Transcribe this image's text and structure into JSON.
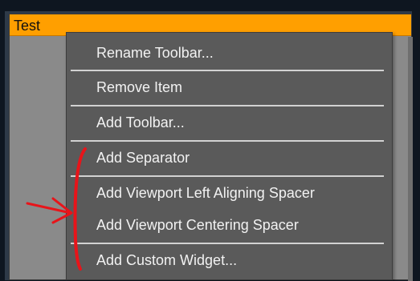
{
  "window": {
    "title": "Test",
    "colors": {
      "titlebar": "#ff9f00",
      "menu_bg": "#5a5a5a",
      "menu_text": "#f2f2f2",
      "annotation": "#e8141a"
    }
  },
  "context_menu": {
    "items": [
      {
        "label": "Rename Toolbar..."
      },
      {
        "label": "Remove Item"
      },
      {
        "label": "Add Toolbar..."
      },
      {
        "label": "Add Separator"
      },
      {
        "label": "Add Viewport Left Aligning Spacer"
      },
      {
        "label": "Add Viewport Centering Spacer"
      },
      {
        "label": "Add Custom Widget..."
      }
    ]
  },
  "annotation": {
    "marks": [
      "red-arrow",
      "red-bracket"
    ]
  }
}
